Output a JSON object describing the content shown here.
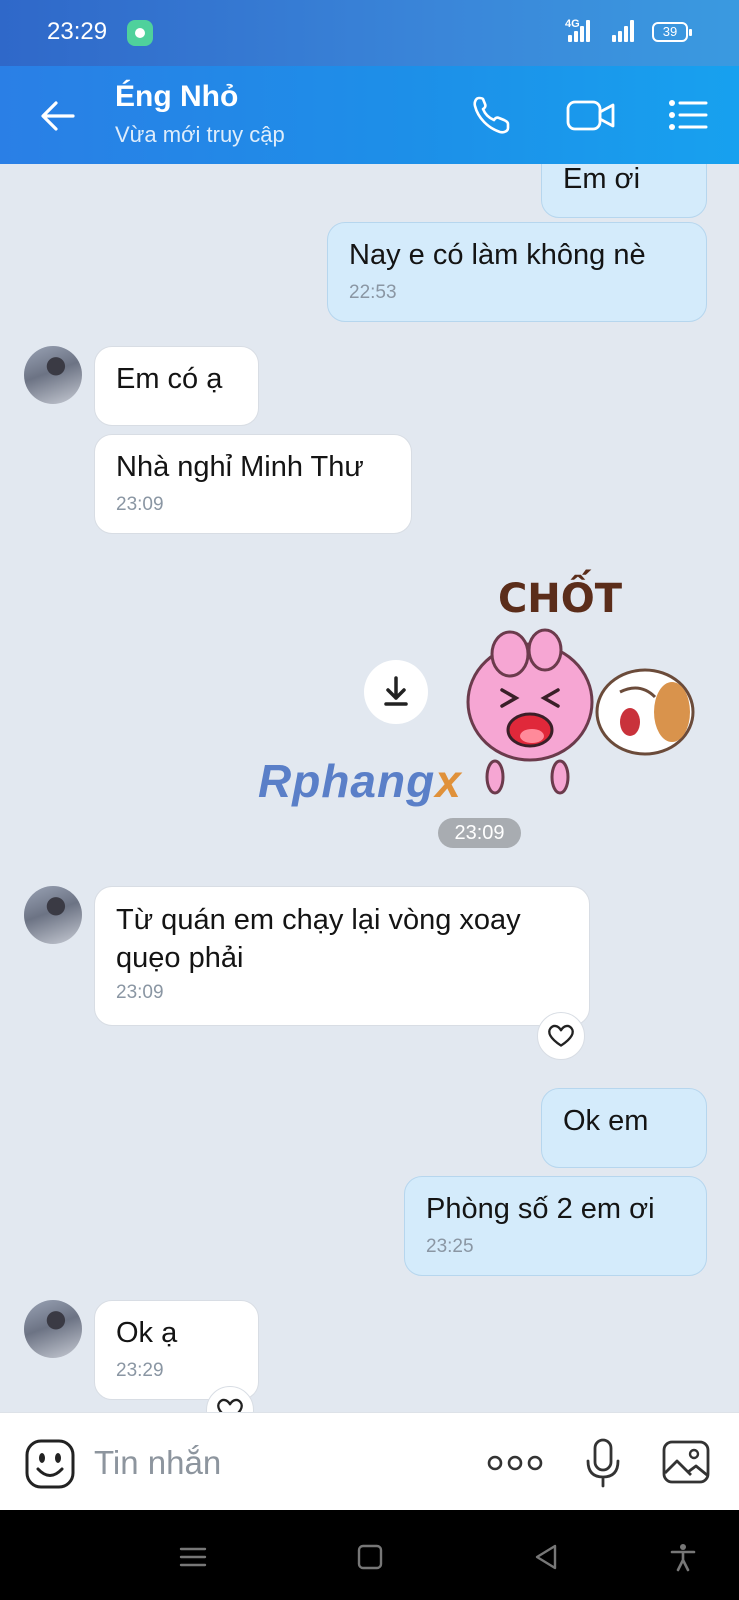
{
  "status_bar": {
    "time": "23:29",
    "network": "4G",
    "battery": "39"
  },
  "header": {
    "contact_name": "Éng Nhỏ",
    "status": "Vừa mới truy cập"
  },
  "messages": [
    {
      "id": "m1",
      "direction": "out",
      "text": "Em ơi",
      "time": ""
    },
    {
      "id": "m2",
      "direction": "out",
      "text": "Nay e có làm không nè",
      "time": "22:53"
    },
    {
      "id": "m3",
      "direction": "in",
      "text": "Em có ạ",
      "time": ""
    },
    {
      "id": "m4",
      "direction": "in",
      "text": "Nhà nghỉ Minh Thư",
      "time": "23:09"
    },
    {
      "id": "m5",
      "direction": "out",
      "type": "sticker",
      "sticker_text": "CHỐT",
      "time": "23:09"
    },
    {
      "id": "m6",
      "direction": "in",
      "text": "Từ quán em chạy lại vòng xoay quẹo phải",
      "time": "23:09"
    },
    {
      "id": "m7",
      "direction": "out",
      "text": "Ok em",
      "time": ""
    },
    {
      "id": "m8",
      "direction": "out",
      "text": "Phòng số 2 em ơi",
      "time": "23:25"
    },
    {
      "id": "m9",
      "direction": "in",
      "text": "Ok ạ",
      "time": "23:29"
    }
  ],
  "watermark": {
    "main": "Rphang",
    "accent": "x"
  },
  "input": {
    "placeholder": "Tin nhắn"
  },
  "icons": {
    "back": "arrow-left-icon",
    "call": "phone-icon",
    "video": "video-camera-icon",
    "menu": "list-menu-icon",
    "emoji": "emoji-icon",
    "more": "more-dots-icon",
    "mic": "microphone-icon",
    "gallery": "image-icon",
    "download": "download-icon",
    "reaction": "heart-icon"
  },
  "colors": {
    "header_start": "#2a7fe6",
    "header_end": "#17a1ef",
    "outgoing_bubble": "#d4ebfb",
    "incoming_bubble": "#ffffff",
    "chat_background": "#e2e8f0"
  }
}
